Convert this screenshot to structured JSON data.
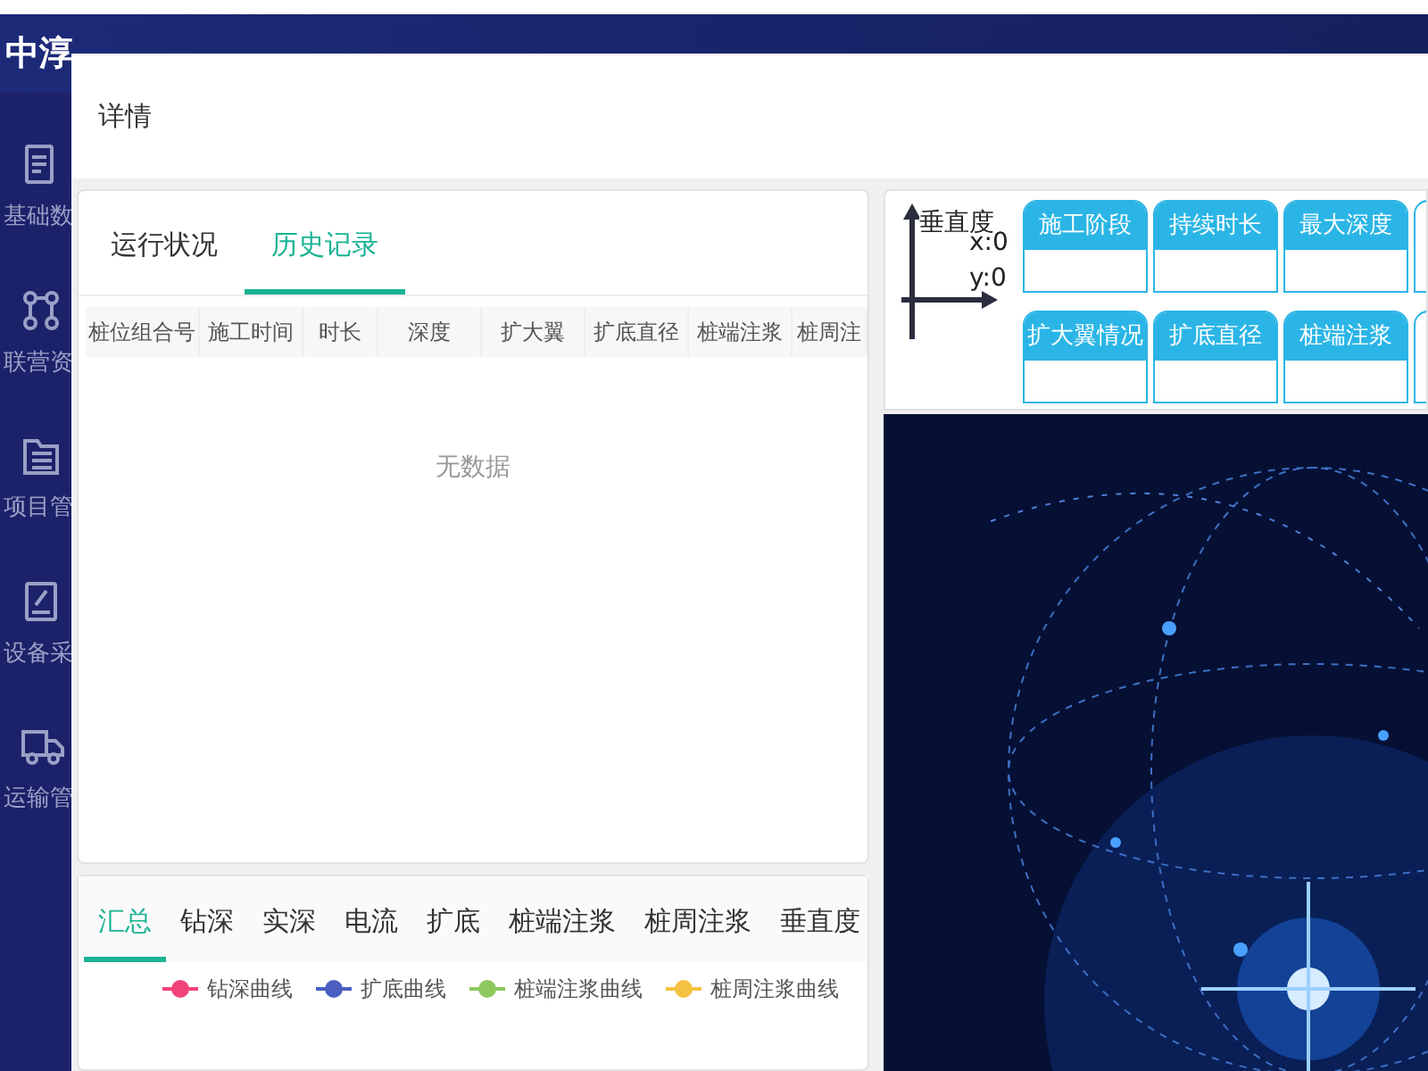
{
  "app": {
    "title": "中淳"
  },
  "sidebar": {
    "items": [
      {
        "label": "基础数",
        "kind": "document"
      },
      {
        "label": "联营资",
        "kind": "nodes"
      },
      {
        "label": "项目管",
        "kind": "folder"
      },
      {
        "label": "设备采",
        "kind": "tablet"
      },
      {
        "label": "运输管",
        "kind": "truck"
      }
    ]
  },
  "dialog": {
    "title": "详情",
    "status_tabs": [
      {
        "label": "运行状况",
        "selected": false
      },
      {
        "label": "历史记录",
        "selected": true
      }
    ],
    "table": {
      "columns": [
        "桩位组合号",
        "施工时间",
        "时长",
        "深度",
        "扩大翼",
        "扩底直径",
        "桩端注浆",
        "桩周注"
      ],
      "empty_text": "无数据"
    },
    "chart_tabs": [
      {
        "label": "汇总",
        "selected": true
      },
      {
        "label": "钻深",
        "selected": false
      },
      {
        "label": "实深",
        "selected": false
      },
      {
        "label": "电流",
        "selected": false
      },
      {
        "label": "扩底",
        "selected": false
      },
      {
        "label": "桩端注浆",
        "selected": false
      },
      {
        "label": "桩周注浆",
        "selected": false
      },
      {
        "label": "垂直度",
        "selected": false
      }
    ],
    "legend": [
      {
        "name": "钻深曲线",
        "color": "#f0437a"
      },
      {
        "name": "扩底曲线",
        "color": "#4a5fc1"
      },
      {
        "name": "桩端注浆曲线",
        "color": "#8dc75e"
      },
      {
        "name": "桩周注浆曲线",
        "color": "#f5c242"
      }
    ],
    "axis": {
      "title": "垂直度",
      "x": "x:0",
      "y": "y:0"
    },
    "metric_rows": [
      [
        {
          "label": "施工阶段"
        },
        {
          "label": "持续时长"
        },
        {
          "label": "最大深度"
        }
      ],
      [
        {
          "label": "扩大翼情况"
        },
        {
          "label": "扩底直径"
        },
        {
          "label": "桩端注浆"
        }
      ]
    ],
    "video": {
      "kind": "picture"
    }
  }
}
